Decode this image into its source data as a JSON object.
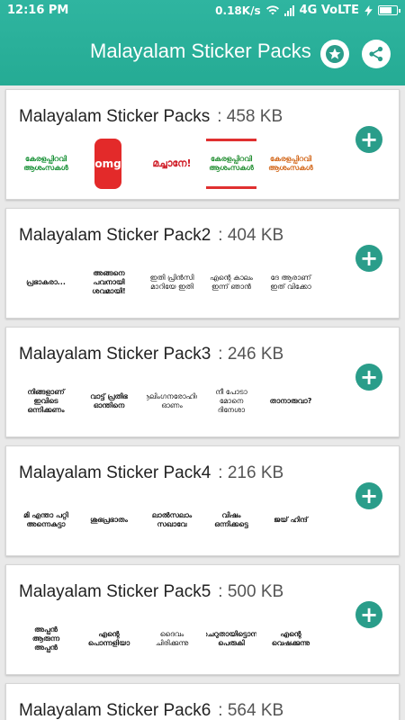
{
  "status_bar": {
    "time": "12:16 PM",
    "speed": "0.18K/s",
    "network": "4G VoLTE"
  },
  "app_bar": {
    "title": "Malayalam Sticker Packs",
    "star_icon": "star-icon",
    "share_icon": "share-icon",
    "accent": "#26AE97"
  },
  "packs": [
    {
      "name": "Malayalam Sticker Packs",
      "size": ": 458 KB",
      "stickers": [
        "കേരളപ്പിറവി ആശംസകൾ",
        "omg",
        "മച്ചാനേ!",
        "കേരളപ്പിറവി ആശംസകൾ",
        "കേരളപ്പിറവി ആശംസകൾ"
      ]
    },
    {
      "name": "Malayalam Sticker Pack2",
      "size": ": 404 KB",
      "stickers": [
        "പ്രഭാകരാ...",
        "അങ്ങനെ പവനായി ശവമായി!",
        "ഇതി പ്രിൻസി മാറിയേ ഇതി",
        "എന്റെ കാലം ഇന്ന് ഞാൻ",
        "ദേ ആരാണ് ഇത് വിക്കോ"
      ]
    },
    {
      "name": "Malayalam Sticker Pack3",
      "size": ": 246 KB",
      "stickers": [
        "നിങ്ങളാണ് ഇവിടെ ഒന്നിക്കണം",
        "വാട്ട് പ്രതിഭ ഓന്തിനെ",
        "ആലിംഗനരോഹിതം ഓണം",
        "നീ പോടാ മോനെ ദിനേശാ",
        "താനാരുവാ?"
      ]
    },
    {
      "name": "Malayalam Sticker Pack4",
      "size": ": 216 KB",
      "stickers": [
        "മി എന്താ പറ്റി അന്നെകുട്ടാ",
        "ശുഭപ്രഭാതം",
        "ലാൽസലാം സഖാവേ",
        "വിഷം ഒന്നിക്കട്ടെ",
        "ജയ് ഹിന്ദ്"
      ]
    },
    {
      "name": "Malayalam Sticker Pack5",
      "size": ": 500 KB",
      "stickers": [
        "അപ്പൻ ആരുന്ന അപ്പൻ",
        "എന്റെ പൊന്നളിയാ",
        "ദൈവം ചിരിക്കുന്നു",
        "ചെറുതായിട്ടൊന്ന് പെരുകി",
        "എന്റെ വെഷക്കുന്നു"
      ]
    },
    {
      "name": "Malayalam Sticker Pack6",
      "size": ": 564 KB",
      "stickers": []
    }
  ],
  "add_icon": "plus-icon"
}
